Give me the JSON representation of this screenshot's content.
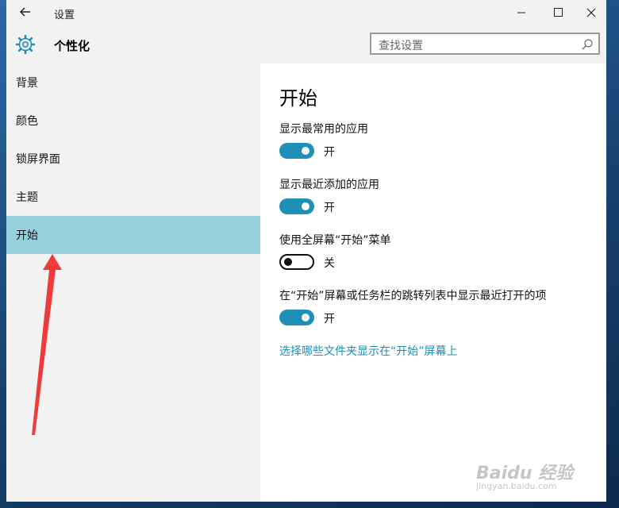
{
  "window": {
    "title": "设置"
  },
  "header": {
    "title": "个性化",
    "search_placeholder": "查找设置"
  },
  "sidebar": {
    "items": [
      {
        "label": "背景"
      },
      {
        "label": "颜色"
      },
      {
        "label": "锁屏界面"
      },
      {
        "label": "主题"
      },
      {
        "label": "开始",
        "active": true
      }
    ]
  },
  "main": {
    "title": "开始",
    "settings": [
      {
        "label": "显示最常用的应用",
        "on": true,
        "state": "开"
      },
      {
        "label": "显示最近添加的应用",
        "on": true,
        "state": "开"
      },
      {
        "label": "使用全屏幕“开始”菜单",
        "on": false,
        "state": "关"
      },
      {
        "label": "在“开始”屏幕或任务栏的跳转列表中显示最近打开的项",
        "on": true,
        "state": "开"
      }
    ],
    "link": "选择哪些文件夹显示在“开始”屏幕上"
  },
  "watermark": {
    "brand": "Baidu 经验",
    "url": "jingyan.baidu.com"
  },
  "colors": {
    "accent": "#1e90b8",
    "active_nav": "#94cfdc",
    "annotation": "#ee3b3b"
  }
}
